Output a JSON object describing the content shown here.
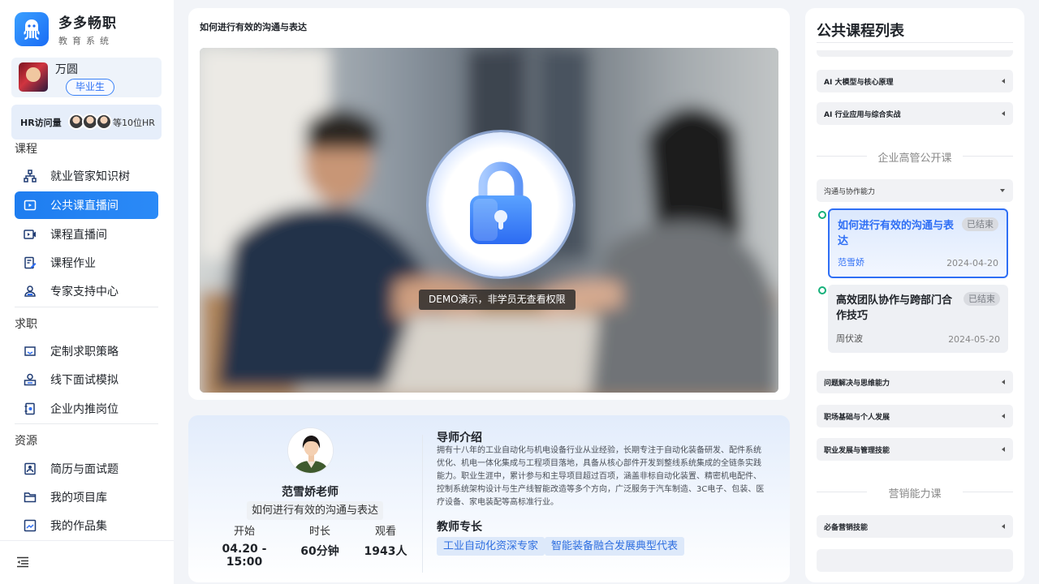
{
  "brand": {
    "name": "多多畅职",
    "subtitle": "教育系统",
    "logo_icon": "octopus-logo-icon"
  },
  "user": {
    "name": "万圆",
    "badge": "毕业生"
  },
  "hr_visits": {
    "label": "HR访问量",
    "count_text": "等10位HR"
  },
  "sidebar": {
    "sections": [
      {
        "title": "课程",
        "items": [
          {
            "label": "就业管家知识树",
            "icon": "tree-structure-icon",
            "active": false
          },
          {
            "label": "公共课直播间",
            "icon": "live-room-icon",
            "active": true
          },
          {
            "label": "课程直播间",
            "icon": "video-camera-icon",
            "active": false
          },
          {
            "label": "课程作业",
            "icon": "homework-edit-icon",
            "active": false
          },
          {
            "label": "专家支持中心",
            "icon": "expert-support-icon",
            "active": false
          }
        ]
      },
      {
        "title": "求职",
        "items": [
          {
            "label": "定制求职策略",
            "icon": "strategy-icon",
            "active": false
          },
          {
            "label": "线下面试模拟",
            "icon": "interview-icon",
            "active": false
          },
          {
            "label": "企业内推岗位",
            "icon": "referral-icon",
            "active": false
          }
        ]
      },
      {
        "title": "资源",
        "items": [
          {
            "label": "简历与面试题",
            "icon": "resume-icon",
            "active": false
          },
          {
            "label": "我的项目库",
            "icon": "folder-icon",
            "active": false
          },
          {
            "label": "我的作品集",
            "icon": "portfolio-icon",
            "active": false
          }
        ]
      }
    ]
  },
  "video": {
    "title": "如何进行有效的沟通与表达",
    "lock_message": "DEMO演示，非学员无查看权限"
  },
  "teacher": {
    "name": "范雪娇老师",
    "course": "如何进行有效的沟通与表达",
    "stats": [
      {
        "label": "开始",
        "value": "04.20 - 15:00"
      },
      {
        "label": "时长",
        "value": "60分钟"
      },
      {
        "label": "观看",
        "value": "1943人"
      }
    ],
    "intro_heading": "导师介绍",
    "intro_text": "拥有十八年的工业自动化与机电设备行业从业经验，长期专注于自动化装备研发、配件系统优化、机电一体化集成与工程项目落地，具备从核心部件开发到整线系统集成的全链条实践能力。职业生涯中，累计参与和主导项目超过百项，涵盖非标自动化装置、精密机电配件、控制系统架构设计与生产线智能改造等多个方向，广泛服务于汽车制造、3C电子、包装、医疗设备、家电装配等高标准行业。",
    "skills_heading": "教师专长",
    "skills": [
      "工业自动化资深专家",
      "智能装备融合发展典型代表"
    ]
  },
  "course_list": {
    "title": "公共课程列表",
    "top_accordions": [
      "AI 大模型与核心原理",
      "AI 行业应用与综合实战"
    ],
    "group1": {
      "heading": "企业高管公开课",
      "open_accordion": "沟通与协作能力",
      "lessons": [
        {
          "title": "如何进行有效的沟通与表达",
          "status": "已结束",
          "teacher": "范雪娇",
          "date": "2024-04-20",
          "active": true
        },
        {
          "title": "高效团队协作与跨部门合作技巧",
          "status": "已结束",
          "teacher": "周伏波",
          "date": "2024-05-20",
          "active": false
        }
      ],
      "more_accordions": [
        "问题解决与思维能力",
        "职场基础与个人发展",
        "职业发展与管理技能"
      ]
    },
    "group2": {
      "heading": "营销能力课",
      "accordions": [
        "必备营销技能"
      ]
    }
  },
  "colors": {
    "accent": "#1e7df0",
    "active_border": "#2f6ff5",
    "timeline_dot": "#15b07a"
  }
}
